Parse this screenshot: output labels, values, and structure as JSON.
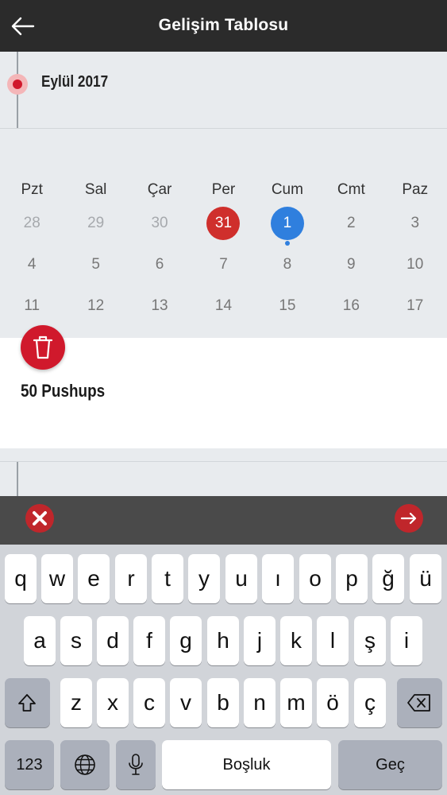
{
  "header": {
    "title": "Gelişim Tablosu"
  },
  "month": {
    "label": "Eylül 2017"
  },
  "calendar": {
    "weekdays": [
      "Pzt",
      "Sal",
      "Çar",
      "Per",
      "Cum",
      "Cmt",
      "Paz"
    ],
    "weeks": [
      [
        "28",
        "29",
        "30",
        "31",
        "1",
        "2",
        "3"
      ],
      [
        "4",
        "5",
        "6",
        "7",
        "8",
        "9",
        "10"
      ],
      [
        "11",
        "12",
        "13",
        "14",
        "15",
        "16",
        "17"
      ]
    ],
    "selected_day": "31",
    "today": "1",
    "colors": {
      "selected": "#cf2f2c",
      "today": "#2f7fde"
    }
  },
  "entry": {
    "title": "50 Pushups"
  },
  "keyboard": {
    "row1": [
      "q",
      "w",
      "e",
      "r",
      "t",
      "y",
      "u",
      "ı",
      "o",
      "p",
      "ğ",
      "ü"
    ],
    "row2": [
      "a",
      "s",
      "d",
      "f",
      "g",
      "h",
      "j",
      "k",
      "l",
      "ş",
      "i"
    ],
    "row3": [
      "z",
      "x",
      "c",
      "v",
      "b",
      "n",
      "m",
      "ö",
      "ç"
    ],
    "numbers_label": "123",
    "space_label": "Boşluk",
    "return_label": "Geç"
  },
  "icons": {
    "back": "arrow-left-icon",
    "trash": "trash-icon",
    "cancel": "close-circle-icon",
    "next": "arrow-right-icon",
    "shift": "shift-icon",
    "delete": "backspace-icon",
    "globe": "globe-icon",
    "mic": "microphone-icon"
  },
  "accent_color": "#d0192c"
}
